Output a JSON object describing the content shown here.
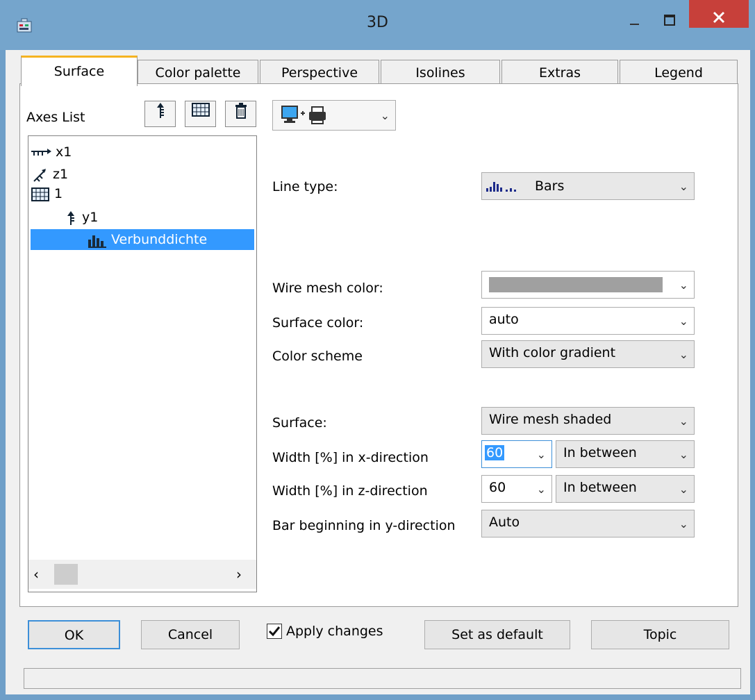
{
  "window": {
    "title": "3D"
  },
  "tabs": [
    "Surface",
    "Color palette",
    "Perspective",
    "Isolines",
    "Extras",
    "Legend"
  ],
  "axes_list": {
    "label": "Axes List",
    "items": [
      {
        "label": "x1",
        "icon": "x-axis-icon"
      },
      {
        "label": "z1",
        "icon": "z-axis-icon"
      },
      {
        "label": "1",
        "icon": "grid-icon"
      },
      {
        "label": "y1",
        "icon": "y-axis-icon"
      },
      {
        "label": "Verbunddichte",
        "icon": "bar-chart-icon",
        "selected": true
      }
    ]
  },
  "form": {
    "line_type": {
      "label": "Line type:",
      "value": "Bars"
    },
    "wire_mesh_color": {
      "label": "Wire mesh color:",
      "value": "",
      "swatch": "#a0a0a0"
    },
    "surface_color": {
      "label": "Surface color:",
      "value": "auto"
    },
    "color_scheme": {
      "label": "Color scheme",
      "value": "With color gradient"
    },
    "surface": {
      "label": "Surface:",
      "value": "Wire mesh shaded"
    },
    "width_x": {
      "label": "Width [%] in x-direction",
      "value": "60",
      "mode": "In between"
    },
    "width_z": {
      "label": "Width [%] in z-direction",
      "value": "60",
      "mode": "In between"
    },
    "bar_beginning": {
      "label": "Bar beginning in y-direction",
      "value": "Auto"
    }
  },
  "buttons": {
    "ok": "OK",
    "cancel": "Cancel",
    "apply_changes": "Apply changes",
    "set_default": "Set as default",
    "topic": "Topic"
  },
  "colors": {
    "accent_tab": "#f5b321",
    "selection": "#3399ff",
    "close": "#c7403a"
  }
}
